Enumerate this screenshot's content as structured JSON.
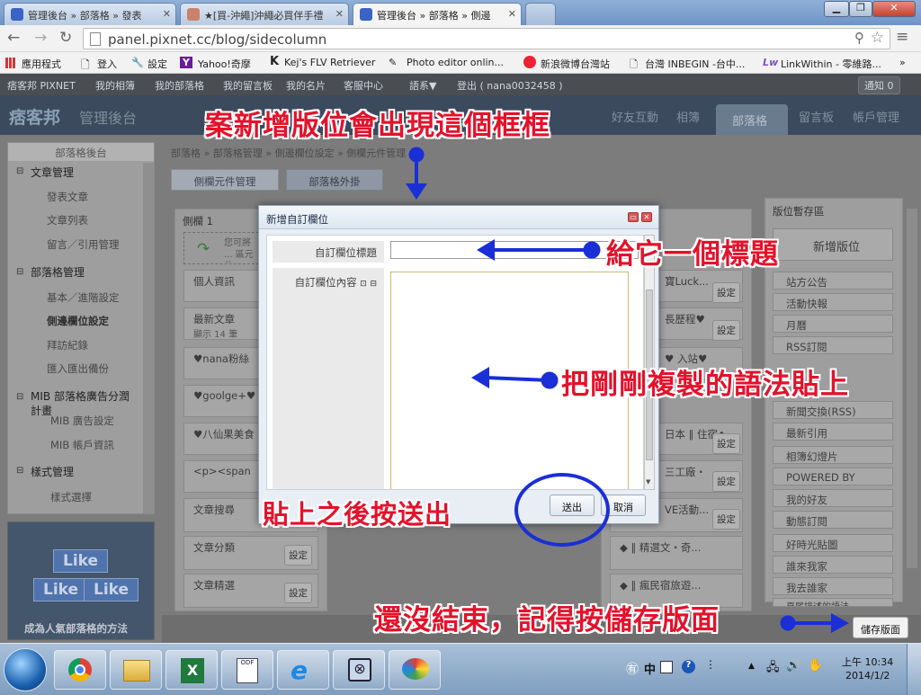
{
  "browser": {
    "tabs": [
      {
        "title": "管理後台 » 部落格 » 發表"
      },
      {
        "title": "★[買-沖繩]沖繩必買伴手禮"
      },
      {
        "title": "管理後台 » 部落格 » 側邊"
      }
    ],
    "url": "panel.pixnet.cc/blog/sidecolumn",
    "bookmarks": [
      "應用程式",
      "登入",
      "設定",
      "Yahoo!奇摩",
      "Kej's FLV Retriever",
      "Photo editor onlin...",
      "新浪微博台灣站",
      "台灣 INBEGIN -台中...",
      "LinkWithin - 零維路...",
      "»"
    ]
  },
  "site": {
    "topnav": [
      "痞客邦 PIXNET",
      "我的相簿",
      "我的部落格",
      "我的留言板",
      "我的名片",
      "客服中心",
      "語系▼",
      "登出 ( nana0032458 )"
    ],
    "notify": "通知 0",
    "brand": "痞客邦",
    "brand_sub": "管理後台",
    "main_nav": [
      "好友互動",
      "相簿",
      "部落格",
      "留言板",
      "帳戶管理"
    ],
    "breadcrumb": "部落格 » 部落格管理 » 側邊欄位設定 » 側欄元件管理",
    "sub_tabs": [
      "側欄元件管理",
      "部落格外掛"
    ],
    "sidebar": {
      "title": "部落格後台",
      "sections": [
        {
          "head": "文章管理",
          "items": [
            "發表文章",
            "文章列表",
            "留言／引用管理"
          ]
        },
        {
          "head": "部落格管理",
          "items": [
            "基本／進階設定",
            "側邊欄位設定",
            "拜訪紀錄",
            "匯入匯出備份"
          ]
        },
        {
          "head": "MIB 部落格廣告分潤計畫",
          "items": [
            "MIB 廣告設定",
            "MIB 帳戶資訊"
          ]
        },
        {
          "head": "樣式管理",
          "items": [
            "樣式選擇"
          ]
        }
      ],
      "promo": "成為人氣部落格的方法",
      "promo_badge": "Like"
    },
    "column1": {
      "title": "側欄 1",
      "hint": "您可將 ... 區元件",
      "items": [
        "個人資訊",
        "最新文章",
        "顯示 14 筆",
        "♥nana粉絲",
        "♥goolge+♥",
        "♥八仙果美食",
        "<p><span",
        "文章搜尋",
        "文章分類",
        "文章精選"
      ],
      "set_label": "設定"
    },
    "column2_items": [
      "寶Luck...",
      "長歷程♥",
      "♥ 入站♥",
      "日本 ‖ 住宿◆",
      "三工廠・",
      "VE活動...",
      "◆ ‖ 精選文・奇...",
      "◆ ‖ 瘋民宿旅遊..."
    ],
    "staging": {
      "title": "版位暫存區",
      "add_button": "新增版位",
      "items": [
        "站方公告",
        "活動快報",
        "月曆",
        "RSS訂閱",
        "新聞交換(RSS)",
        "最新引用",
        "相簿幻燈片",
        "POWERED BY",
        "我的好友",
        "動態訂閱",
        "好時光貼圖",
        "誰來我家",
        "我去誰家",
        "頁尾描述的語法"
      ]
    },
    "save_layout": "儲存版面"
  },
  "dialog": {
    "title": "新增自訂欄位",
    "title_label": "自訂欄位標題",
    "title_value": "",
    "content_label": "自訂欄位內容",
    "submit": "送出",
    "cancel": "取消"
  },
  "annotations": {
    "top": "案新增版位會出現這個框框",
    "give_title": "給它一個標題",
    "paste": "把剛剛複製的語法貼上",
    "submit_hint": "貼上之後按送出",
    "save_hint": "還沒結束，記得按儲存版面"
  },
  "colors": {
    "annotation_text": "#e3122b",
    "annotation_arrow": "#1a2fd6"
  },
  "taskbar": {
    "time": "上午 10:34",
    "date": "2014/1/2",
    "ime": "中",
    "apps": [
      "start-orb",
      "chrome",
      "file-explorer",
      "excel",
      "odf-document",
      "internet-explorer",
      "tool-app",
      "paint-app"
    ]
  }
}
